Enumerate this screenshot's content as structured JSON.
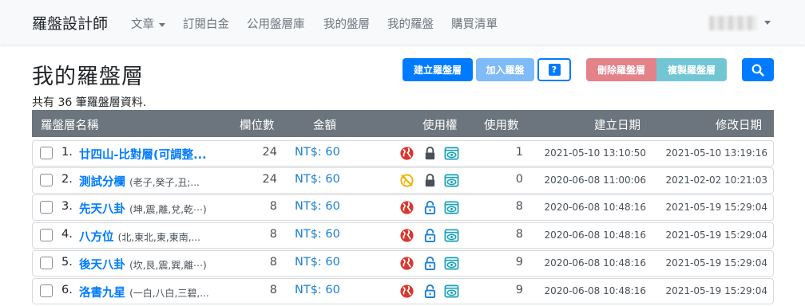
{
  "navbar": {
    "brand": "羅盤設計師",
    "items": [
      {
        "label": "文章",
        "dropdown": true
      },
      {
        "label": "訂閱白金"
      },
      {
        "label": "公用盤層庫"
      },
      {
        "label": "我的盤層"
      },
      {
        "label": "我的羅盤"
      },
      {
        "label": "購買清單"
      }
    ]
  },
  "page": {
    "title": "我的羅盤層",
    "count_text": "共有 36 筆羅盤層資料."
  },
  "toolbar": {
    "create_label": "建立羅盤層",
    "join_label": "加入羅盤",
    "help_label": "?",
    "delete_label": "刪除羅盤層",
    "copy_label": "複製羅盤層",
    "search_icon": "search-icon"
  },
  "table": {
    "headers": {
      "name": "羅盤層名稱",
      "columns": "欄位數",
      "price": "金額",
      "access": "使用權",
      "uses": "使用數",
      "created": "建立日期",
      "modified": "修改日期"
    },
    "rows": [
      {
        "index": "1.",
        "name": "廿四山-比對層(可調整...",
        "detail": "",
        "columns": "24",
        "price": "NT$: 60",
        "public": true,
        "locked": true,
        "uses": "1",
        "created": "2021-05-10 13:10:50",
        "modified": "2021-05-10 13:19:16"
      },
      {
        "index": "2.",
        "name": "測試分欄",
        "detail": "(老子,癸子,丑;...",
        "columns": "24",
        "price": "NT$: 60",
        "public": false,
        "locked": true,
        "uses": "0",
        "created": "2020-06-08 11:00:06",
        "modified": "2021-02-02 10:21:03"
      },
      {
        "index": "3.",
        "name": "先天八卦",
        "detail": "(坤,震,離,兌,乾⋯)",
        "columns": "8",
        "price": "NT$: 60",
        "public": true,
        "locked": false,
        "uses": "8",
        "created": "2020-06-08 10:48:16",
        "modified": "2021-05-19 15:29:04"
      },
      {
        "index": "4.",
        "name": "八方位",
        "detail": "(北,東北,東,東南,...",
        "columns": "8",
        "price": "NT$: 60",
        "public": true,
        "locked": false,
        "uses": "8",
        "created": "2020-06-08 10:48:16",
        "modified": "2021-05-19 15:29:04"
      },
      {
        "index": "5.",
        "name": "後天八卦",
        "detail": "(坎,艮,震,巽,離⋯)",
        "columns": "8",
        "price": "NT$: 60",
        "public": true,
        "locked": false,
        "uses": "9",
        "created": "2020-06-08 10:48:16",
        "modified": "2021-05-19 15:29:04"
      },
      {
        "index": "6.",
        "name": "洛書九星",
        "detail": "(一白,八白,三碧,...",
        "columns": "8",
        "price": "NT$: 60",
        "public": true,
        "locked": false,
        "uses": "9",
        "created": "2020-06-08 10:48:16",
        "modified": "2021-05-19 15:29:04"
      }
    ]
  },
  "colors": {
    "primary": "#007bff",
    "danger": "#dc3545",
    "info": "#17a2b8",
    "warning": "#f0b400",
    "header": "#6c757d"
  }
}
